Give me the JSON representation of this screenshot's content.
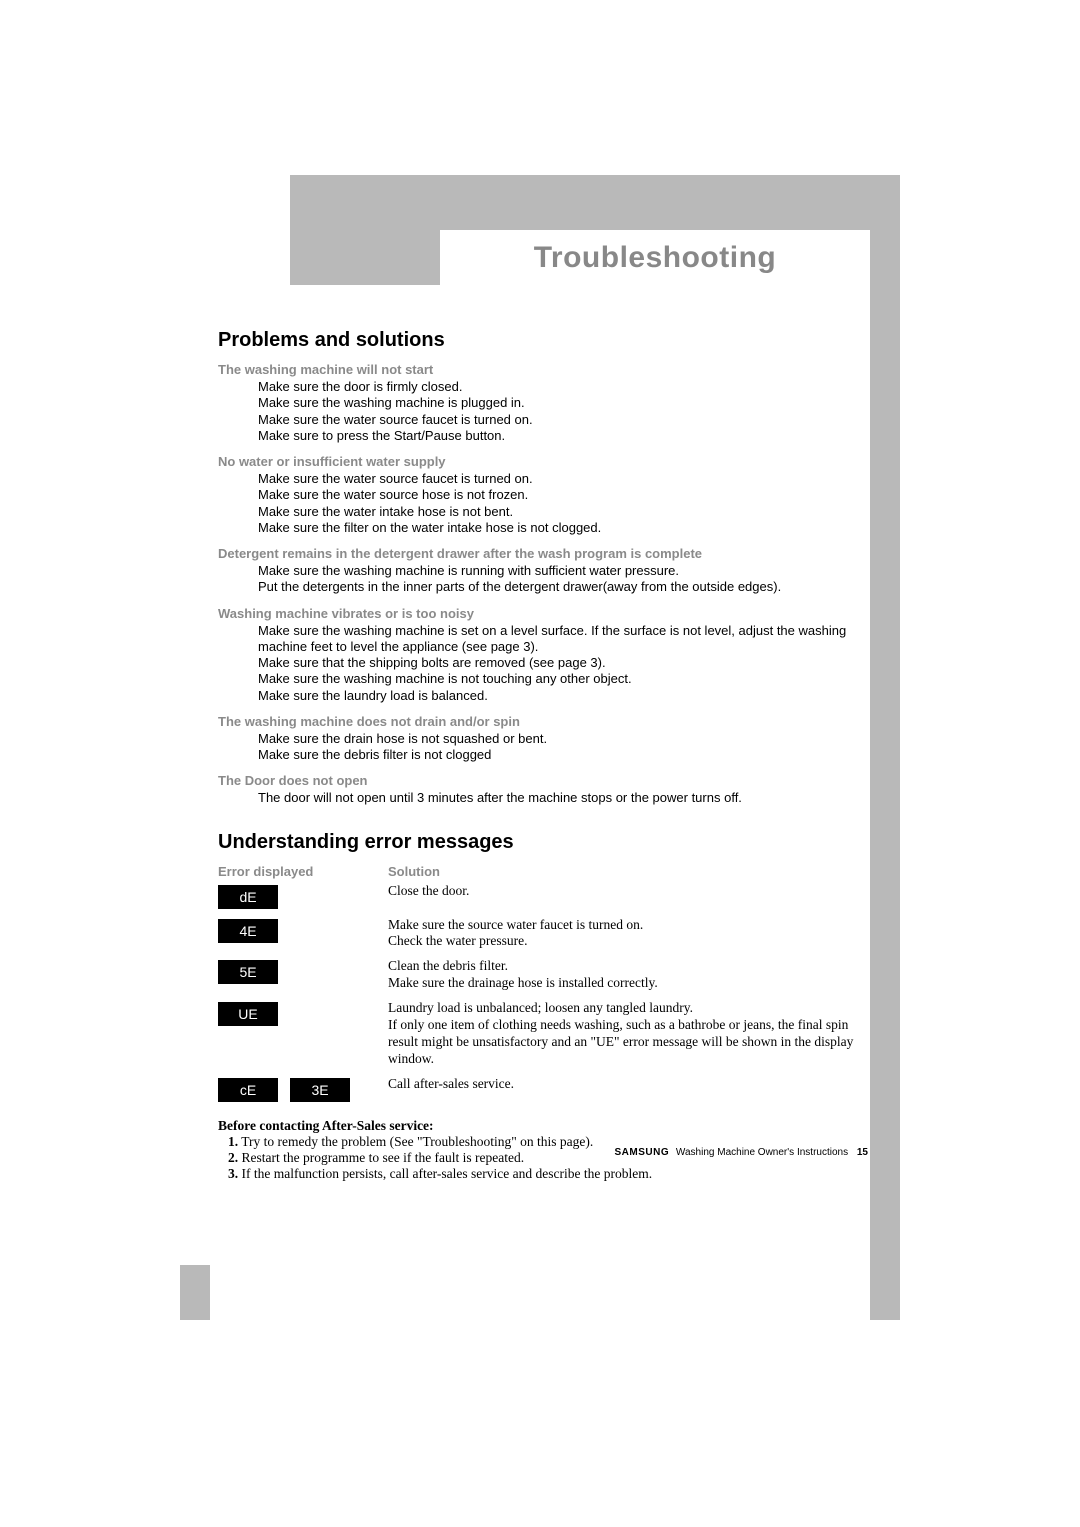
{
  "title": "Troubleshooting",
  "section1": {
    "heading": "Problems and solutions",
    "problems": [
      {
        "title": "The washing machine will not start",
        "items": [
          "Make sure the door is firmly closed.",
          "Make sure the washing machine is plugged in.",
          "Make sure the water source faucet is turned on.",
          "Make sure to press the Start/Pause button."
        ]
      },
      {
        "title": "No water or insufficient water supply",
        "items": [
          "Make sure the water source faucet is turned on.",
          "Make sure the water source hose is not frozen.",
          "Make sure the water intake hose is not bent.",
          "Make sure the filter on the water intake hose is not clogged."
        ]
      },
      {
        "title": "Detergent remains in the detergent drawer after the wash program is complete",
        "items": [
          "Make sure the washing machine is running with sufficient water pressure.",
          "Put the detergents in the inner parts of the detergent drawer(away from the outside edges)."
        ]
      },
      {
        "title": "Washing machine vibrates or is too noisy",
        "items": [
          "Make sure the washing machine is set on a level surface.  If the surface is not level, adjust the washing machine feet to level the appliance (see page 3).",
          "Make sure that the shipping bolts are removed (see page 3).",
          "Make sure the washing machine is not touching any other object.",
          "Make sure the laundry load is balanced."
        ]
      },
      {
        "title": "The washing machine does not drain and/or spin",
        "items": [
          "Make sure the drain hose is not squashed or bent.",
          "Make sure the debris filter is not clogged"
        ]
      },
      {
        "title": "The Door does not open",
        "items": [
          "The door will not open until 3 minutes after the machine stops or the power turns off."
        ]
      }
    ]
  },
  "section2": {
    "heading": "Understanding error messages",
    "head_left": "Error displayed",
    "head_right": "Solution",
    "errors": [
      {
        "codes": [
          "dE"
        ],
        "solution": "Close the door."
      },
      {
        "codes": [
          "4E"
        ],
        "solution": "Make sure the source water faucet is turned on.\nCheck the water pressure."
      },
      {
        "codes": [
          "5E"
        ],
        "solution": "Clean the debris filter.\nMake sure the drainage hose is installed correctly."
      },
      {
        "codes": [
          "UE"
        ],
        "solution": "Laundry load is unbalanced; loosen any tangled laundry.\nIf only one item of clothing needs washing, such as a bathrobe or jeans, the final spin result might be unsatisfactory and an \"UE\" error message will be shown in the display window."
      },
      {
        "codes": [
          "cE",
          "3E"
        ],
        "solution": "Call after-sales service."
      }
    ]
  },
  "before": {
    "title": "Before contacting After-Sales service:",
    "items": [
      {
        "n": "1.",
        "t": "Try to remedy the problem (See \"Troubleshooting\" on this page)."
      },
      {
        "n": "2.",
        "t": "Restart the programme to see if the fault is repeated."
      },
      {
        "n": "3.",
        "t": "If the malfunction persists, call after-sales service and describe the problem."
      }
    ]
  },
  "footer": {
    "brand": "SAMSUNG",
    "text": "Washing Machine Owner's Instructions",
    "page": "15"
  }
}
